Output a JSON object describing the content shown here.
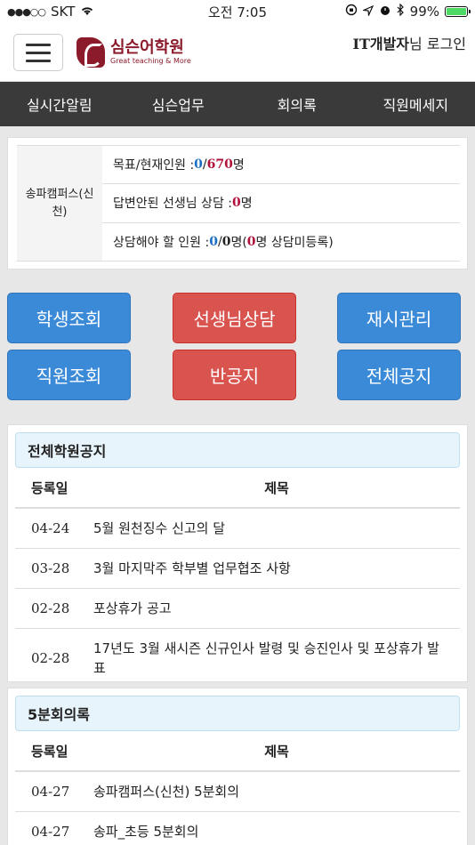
{
  "status_bar": {
    "carrier": "SKT",
    "time": "오전 7:05",
    "battery": "99%",
    "battery_level": 0.99,
    "colors": {
      "battery_fill": "#4cd964"
    }
  },
  "header": {
    "logo_title": "심슨어학원",
    "logo_subtitle": "Great teaching & More",
    "login_user": "IT개발자",
    "login_suffix": "님 로그인",
    "colors": {
      "brand": "#8b1a2b"
    }
  },
  "nav": {
    "items": [
      "실시간알림",
      "심슨업무",
      "회의록",
      "직원메세지"
    ]
  },
  "stats": {
    "campus": "송파캠퍼스(신천)",
    "row1": {
      "label": "목표/현재인원 : ",
      "current": "0",
      "sep": "/",
      "target": "670",
      "unit": " 명"
    },
    "row2": {
      "label": "답변안된 선생님 상담 : ",
      "count": "0",
      "unit": " 명"
    },
    "row3": {
      "label": "상담해야 할 인원 : ",
      "a": "0",
      "sep": "/",
      "b": "0",
      "unit": " 명(",
      "c": "0",
      "tail": "명 상담미등록)"
    }
  },
  "buttons": {
    "student_lookup": "학생조회",
    "teacher_consult": "선생님상담",
    "reexam": "재시관리",
    "staff_lookup": "직원조회",
    "class_notice": "반공지",
    "all_notice": "전체공지",
    "colors": {
      "blue": "#3b8ad8",
      "red": "#d9534f"
    }
  },
  "notices": {
    "title": "전체학원공지",
    "col_date": "등록일",
    "col_title": "제목",
    "rows": [
      {
        "date": "04-24",
        "title": "5월 원천징수 신고의 달"
      },
      {
        "date": "03-28",
        "title": "3월 마지막주 학부별 업무협조 사항"
      },
      {
        "date": "02-28",
        "title": "포상휴가 공고"
      },
      {
        "date": "02-28",
        "title": "17년도 3월 새시즌 신규인사 발령 및 승진인사 및 포상휴가 발표"
      }
    ]
  },
  "minutes": {
    "title": "5분회의록",
    "col_date": "등록일",
    "col_title": "제목",
    "rows": [
      {
        "date": "04-27",
        "title": "송파캠퍼스(신천) 5분회의"
      },
      {
        "date": "04-27",
        "title": "송파_초등 5분회의"
      }
    ]
  }
}
